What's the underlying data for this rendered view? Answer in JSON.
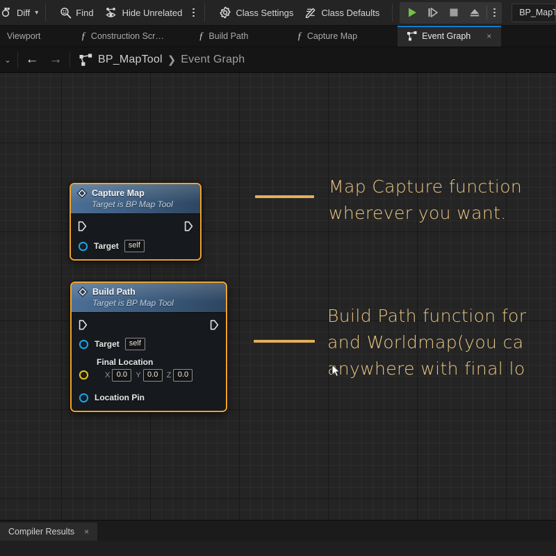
{
  "toolbar": {
    "diff_label": "Diff",
    "find_label": "Find",
    "hide_unrelated_label": "Hide Unrelated",
    "class_settings_label": "Class Settings",
    "class_defaults_label": "Class Defaults",
    "play_label": "Play",
    "step_label": "Step",
    "stop_label": "Stop",
    "eject_label": "Eject",
    "overflow_label": "More options",
    "asset_chip_label": "BP_MapTo"
  },
  "tabs": [
    {
      "label": "Viewport",
      "icon": "none",
      "active": false
    },
    {
      "label": "Construction Scr…",
      "icon": "function-icon",
      "active": false
    },
    {
      "label": "Build Path",
      "icon": "function-icon",
      "active": false
    },
    {
      "label": "Capture Map",
      "icon": "function-icon",
      "active": false
    },
    {
      "label": "Event Graph",
      "icon": "graph-icon",
      "active": true,
      "close": "×"
    }
  ],
  "breadcrumb": {
    "chevron": "⌄",
    "back": "←",
    "forward": "→",
    "root": "BP_MapTool",
    "separator": "❯",
    "current": "Event Graph"
  },
  "graph": {
    "nodes": [
      {
        "id": "capture-map",
        "title": "Capture Map",
        "subtitle": "Target is BP Map Tool",
        "target_label": "Target",
        "target_value": "self"
      },
      {
        "id": "build-path",
        "title": "Build Path",
        "subtitle": "Target is BP Map Tool",
        "target_label": "Target",
        "target_value": "self",
        "vector_label": "Final Location",
        "axis_x": "X",
        "value_x": "0.0",
        "axis_y": "Y",
        "value_y": "0.0",
        "axis_z": "Z",
        "value_z": "0.0",
        "location_pin_label": "Location Pin"
      }
    ],
    "annotations": [
      {
        "line1": "Map Capture function",
        "line2": "wherever you want."
      },
      {
        "line1": "Build Path function for",
        "line2": "and Worldmap(you ca",
        "line3": "anywhere with final lo"
      }
    ]
  },
  "bottom": {
    "compiler_results_label": "Compiler Results",
    "close": "×"
  },
  "colors": {
    "node_selected_border": "#f0a52a",
    "node_header_blue": "#4c6f96",
    "annotation_text": "#e9c583",
    "annotation_line": "#e4b057",
    "exec_pin": "#e8e8e8",
    "object_pin": "#1ba0e0",
    "vector_pin": "#e0c020",
    "active_tab_underline": "#0d7fd4",
    "play_green": "#76c043"
  }
}
